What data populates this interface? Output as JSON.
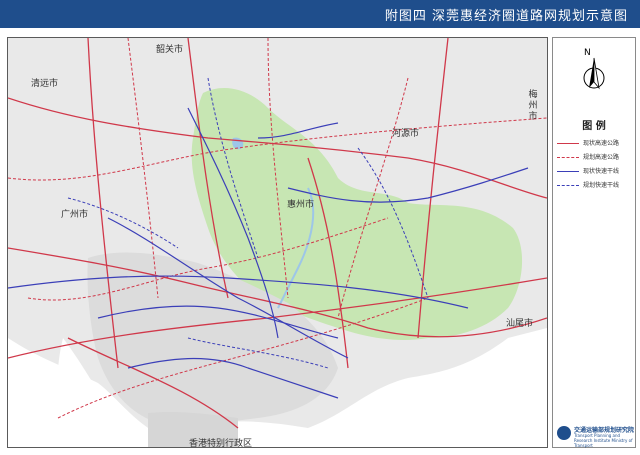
{
  "header": {
    "title": "附图四  深莞惠经济圈道路网规划示意图"
  },
  "map": {
    "city_labels": {
      "shaoguan": "韶关市",
      "qingyuan": "清远市",
      "meizhou": "梅州市",
      "heyuan": "河源市",
      "guangzhou": "广州市",
      "huizhou": "惠州市",
      "shanwei": "汕尾市",
      "hongkong": "香港特别行政区"
    }
  },
  "legend": {
    "north_label": "N",
    "title": "图 例",
    "items": [
      {
        "label": "现状高速公路",
        "color": "#d0384a",
        "style": "solid"
      },
      {
        "label": "规划高速公路",
        "color": "#d0384a",
        "style": "dashed"
      },
      {
        "label": "现状快速干线",
        "color": "#3b3fb8",
        "style": "solid"
      },
      {
        "label": "规划快速干线",
        "color": "#3b3fb8",
        "style": "dashed"
      }
    ]
  },
  "organization": {
    "name": "交通运输部规划研究院",
    "name_en": "Transport Planning and Research Institute Ministry of Transport"
  }
}
